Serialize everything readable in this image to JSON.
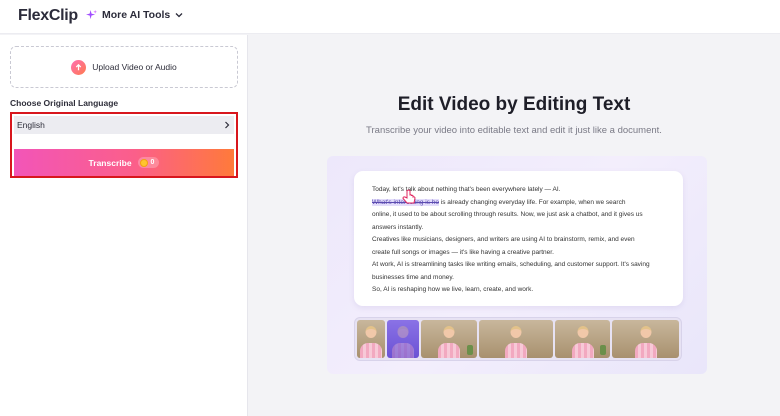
{
  "header": {
    "logo_text": "FlexClip",
    "ai_tools_label": "More AI Tools"
  },
  "sidebar": {
    "upload_label": "Upload Video or Audio",
    "language_heading": "Choose Original Language",
    "language_value": "English",
    "transcribe_label": "Transcribe",
    "credit_count": "0"
  },
  "main": {
    "title": "Edit Video by Editing Text",
    "subtitle": "Transcribe your video into editable text and edit it just like a document.",
    "doc_lines": [
      {
        "pre": "Today, let's talk about ",
        "strike": "",
        "post": "nething that's been everywhere lately — AI."
      },
      {
        "pre": "",
        "strike": "What's interesting is ho",
        "post": "      is already changing everyday life. For example, when we search"
      },
      {
        "pre": "online, it used to be about scrolling through results. Now, we just ask a chatbot, and it gives us",
        "strike": "",
        "post": ""
      },
      {
        "pre": "answers instantly.",
        "strike": "",
        "post": ""
      },
      {
        "pre": "Creatives like musicians, designers, and writers are using AI to brainstorm, remix, and even",
        "strike": "",
        "post": ""
      },
      {
        "pre": "create full songs or images — it's like having a creative partner.",
        "strike": "",
        "post": ""
      },
      {
        "pre": "At work, AI is streamlining tasks like writing emails, scheduling, and customer support. It's saving",
        "strike": "",
        "post": ""
      },
      {
        "pre": "businesses time and money.",
        "strike": "",
        "post": ""
      },
      {
        "pre": "So, AI is reshaping how we live, learn, create, and work.",
        "strike": "",
        "post": ""
      }
    ]
  },
  "colors": {
    "accent_purple": "#7f4dff",
    "highlight_red": "#d8161d",
    "transcribe_gradient_start": "#f255b8",
    "transcribe_gradient_end": "#ff7a3a"
  },
  "icons": [
    "sparkle-icon",
    "chevron-down-icon",
    "upload-icon",
    "chevron-right-icon",
    "coin-icon",
    "hand-cursor-icon"
  ]
}
